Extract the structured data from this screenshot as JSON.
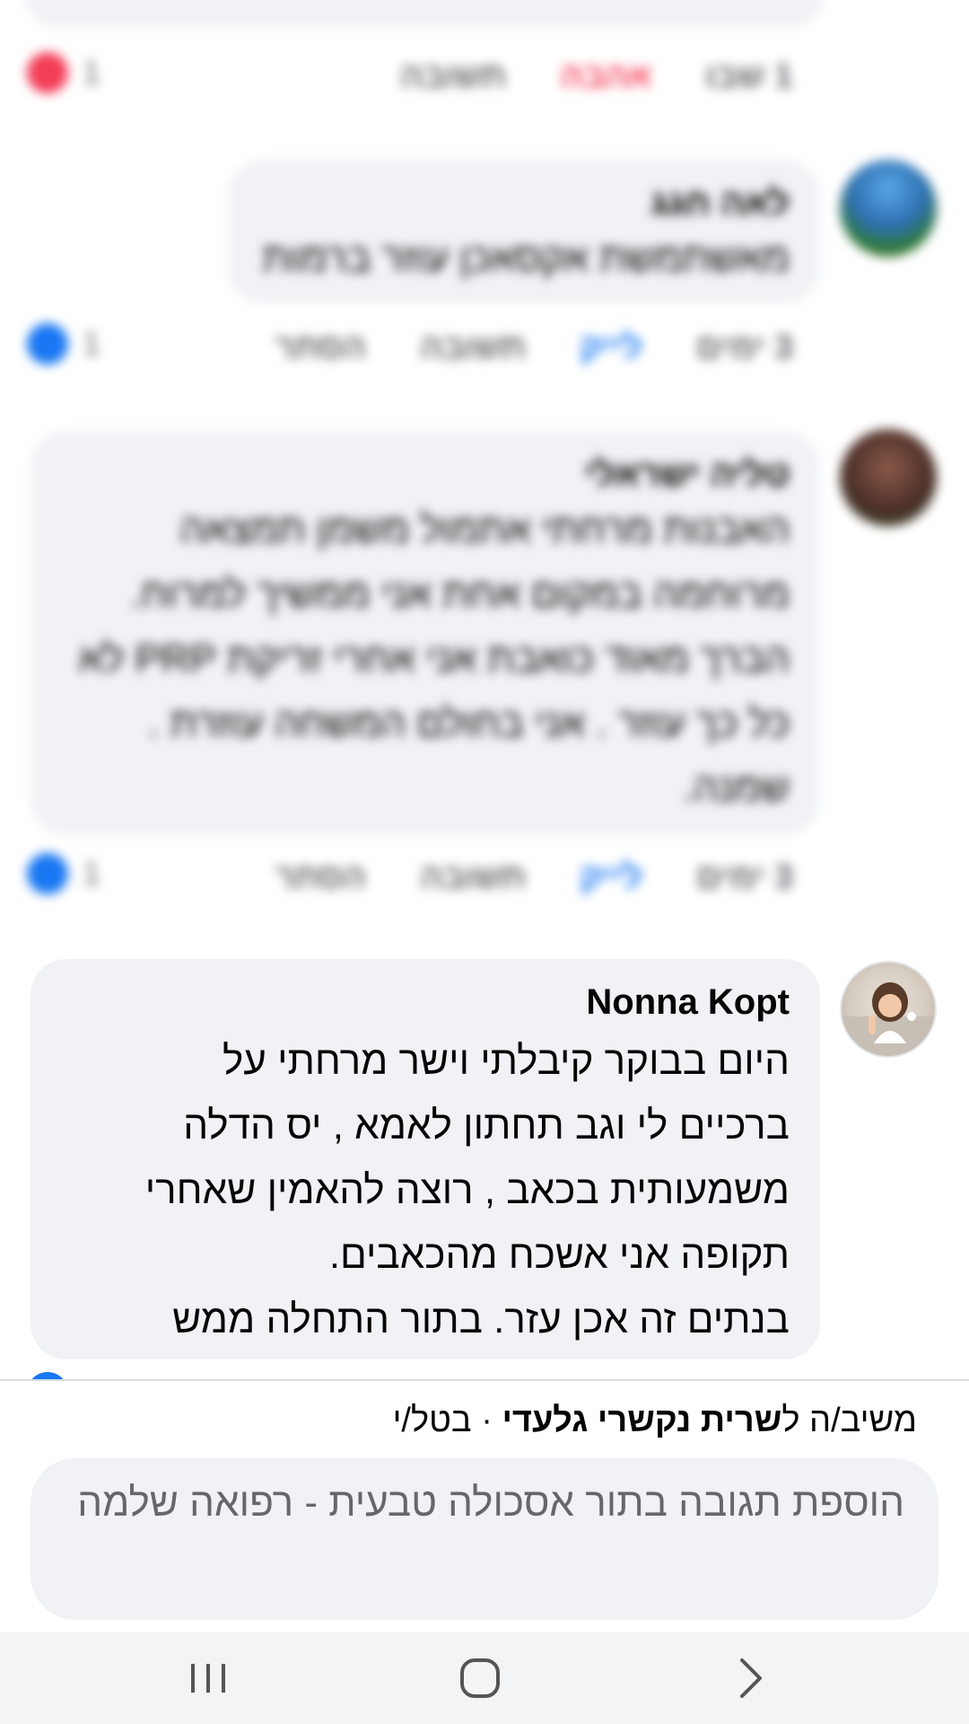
{
  "comments": [
    {
      "actions": {
        "time": "1 שבו",
        "reaction": "אהבה",
        "reply": "תשובה"
      },
      "reaction_count": "1"
    },
    {
      "author": "לאה חגג",
      "text": "מאשתמשת אקסאכן עוזר ברמות",
      "actions": {
        "time": "3 ימים",
        "like": "לייק",
        "reply": "תשובה",
        "hide": "הסתר"
      },
      "reaction_count": "1"
    },
    {
      "author": "טליה ישראלי",
      "text": "האבנות מרחתי אתמול משמן תמצאה מרוחמה במקום אחת אני ממשיך למרוח. הברך מאוד כואבת אני אחרי זריקת PRP לא כל כך עוזר . אני בחולם המשחה עוזרת . שמנה.",
      "actions": {
        "time": "3 ימים",
        "like": "לייק",
        "reply": "תשובה",
        "hide": "הסתר"
      },
      "reaction_count": "1"
    },
    {
      "author": "Nonna Kopt",
      "lines": [
        "היום בבוקר קיבלתי וישר מרחתי על",
        "ברכיים לי וגב תחתון לאמא ,   יס הדלה",
        "משמעותית בכאב , רוצה להאמין שאחרי",
        "תקופה אני אשכח מהכאבים.",
        "בנתים זה אכן עזר. בתור התחלה ממש"
      ]
    }
  ],
  "reply_bar": {
    "prefix": "משיב/ה ל",
    "target": "שרית נקשרי גלעדי",
    "separator": " · ",
    "cancel": "בטל/י",
    "input_text": "הוספת תגובה בתור אסכולה טבעית - רפואה שלמה"
  },
  "colors": {
    "bubble": "#f0f2f5",
    "like_blue": "#1877f2",
    "love_red": "#f33e58",
    "muted": "#65676b"
  },
  "icons": {
    "recent_apps": "recent-apps-icon",
    "home": "home-icon",
    "back": "back-icon"
  }
}
